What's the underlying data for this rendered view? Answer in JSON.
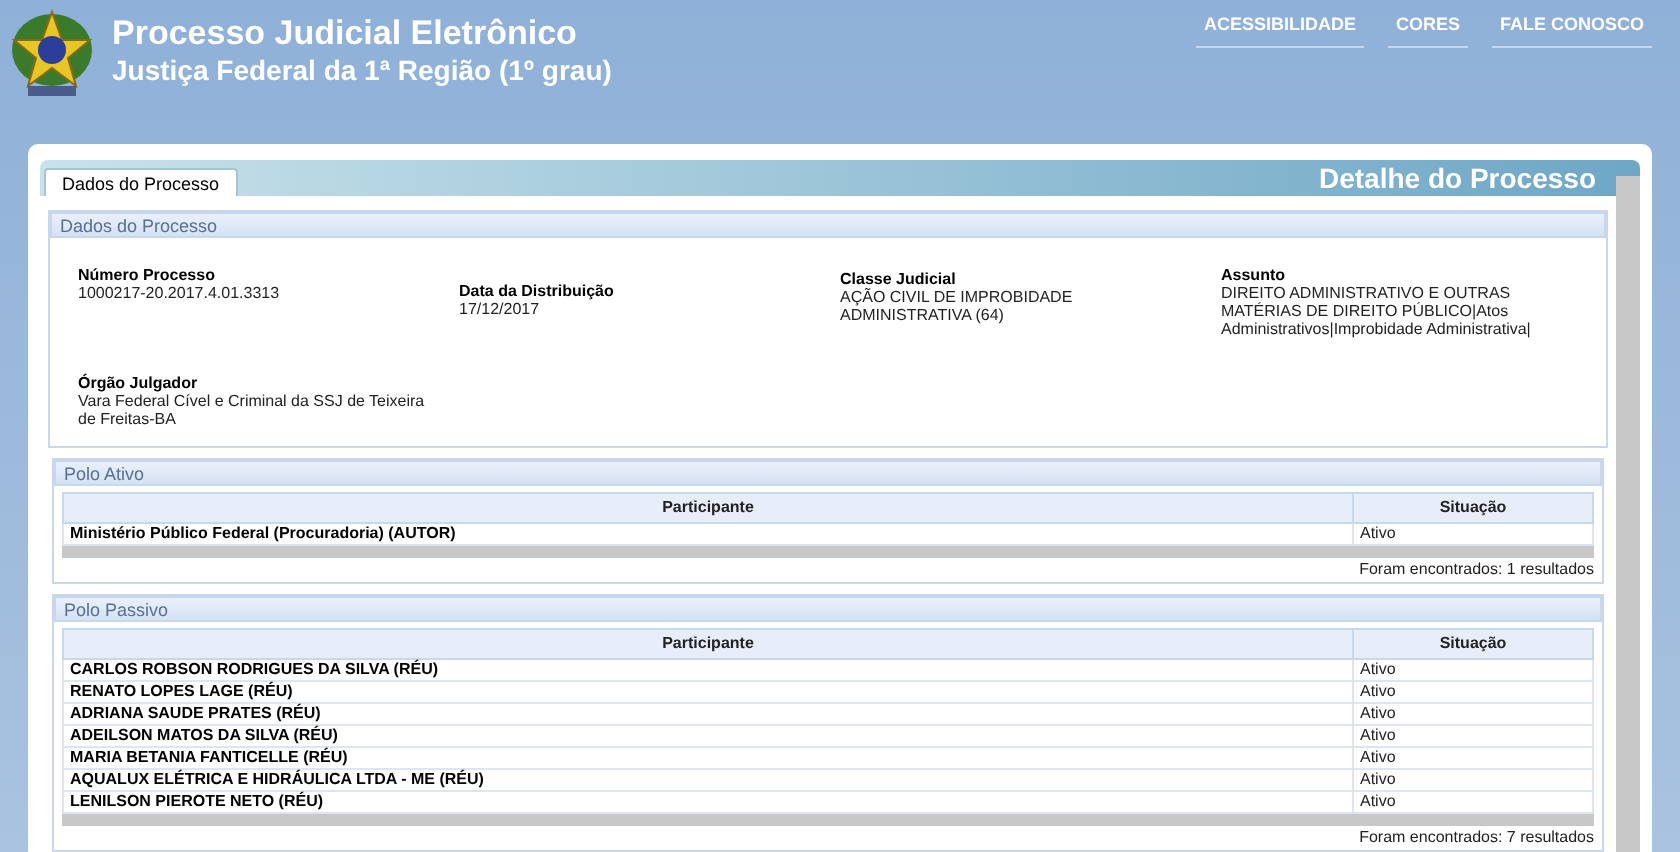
{
  "header": {
    "title": "Processo Judicial Eletrônico",
    "subtitle": "Justiça Federal da 1ª Região (1º grau)",
    "links": [
      "ACESSIBILIDADE",
      "CORES",
      "FALE CONOSCO"
    ]
  },
  "tabs": [
    {
      "label": "Dados do Processo",
      "selected": true
    }
  ],
  "panel_title": "Detalhe do Processo",
  "process_data": {
    "title": "Dados do Processo",
    "fields": [
      {
        "label": "Número Processo",
        "value": "1000217-20.2017.4.01.3313"
      },
      {
        "label": "Data da Distribuição",
        "value": "17/12/2017"
      },
      {
        "label": "Classe Judicial",
        "value": "AÇÃO CIVIL DE IMPROBIDADE ADMINISTRATIVA (64)"
      },
      {
        "label": "Assunto",
        "value": "DIREITO ADMINISTRATIVO E OUTRAS MATÉRIAS DE DIREITO PÚBLICO|Atos Administrativos|Improbidade Administrativa|"
      },
      {
        "label": "Órgão Julgador",
        "value": "Vara Federal Cível e Criminal da SSJ de Teixeira de Freitas-BA"
      }
    ]
  },
  "poles": [
    {
      "title": "Polo Ativo",
      "columns": [
        "Participante",
        "Situação"
      ],
      "rows": [
        [
          "Ministério Público Federal (Procuradoria) (AUTOR)",
          "Ativo"
        ]
      ],
      "footer": "Foram encontrados: 1 resultados"
    },
    {
      "title": "Polo Passivo",
      "columns": [
        "Participante",
        "Situação"
      ],
      "rows": [
        [
          "CARLOS ROBSON RODRIGUES DA SILVA (RÉU)",
          "Ativo"
        ],
        [
          "RENATO LOPES LAGE (RÉU)",
          "Ativo"
        ],
        [
          "ADRIANA SAUDE PRATES (RÉU)",
          "Ativo"
        ],
        [
          "ADEILSON MATOS DA SILVA (RÉU)",
          "Ativo"
        ],
        [
          "MARIA BETANIA FANTICELLE (RÉU)",
          "Ativo"
        ],
        [
          "AQUALUX ELÉTRICA E HIDRÁULICA LTDA - ME (RÉU)",
          "Ativo"
        ],
        [
          "LENILSON PIEROTE NETO (RÉU)",
          "Ativo"
        ]
      ],
      "footer": "Foram encontrados: 7 resultados"
    }
  ]
}
